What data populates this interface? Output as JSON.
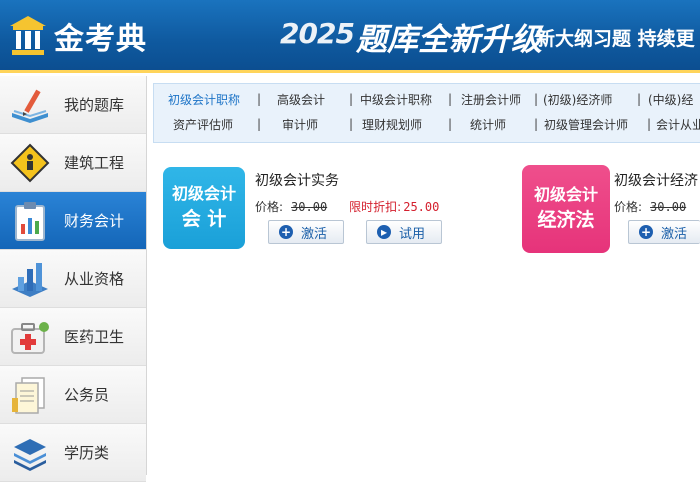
{
  "header": {
    "logo_text": "金考典",
    "banner_year": "2025",
    "banner_main": "题库全新升级",
    "banner_sub": "新大纲习题 持续更"
  },
  "sidebar": {
    "items": [
      {
        "label": "我的题库",
        "icon": "pencil-book-icon"
      },
      {
        "label": "建筑工程",
        "icon": "construction-sign-icon"
      },
      {
        "label": "财务会计",
        "icon": "clipboard-chart-icon"
      },
      {
        "label": "从业资格",
        "icon": "bar-chart-icon"
      },
      {
        "label": "医药卫生",
        "icon": "medical-kit-icon"
      },
      {
        "label": "公务员",
        "icon": "documents-icon"
      },
      {
        "label": "学历类",
        "icon": "layers-icon"
      }
    ],
    "active_index": 2
  },
  "tabs": {
    "row1": [
      "初级会计职称",
      "高级会计",
      "中级会计职称",
      "注册会计师",
      "(初级)经济师",
      "(中级)经"
    ],
    "row2": [
      "资产评估师",
      "审计师",
      "理财规划师",
      "统计师",
      "初级管理会计师",
      "会计从业"
    ],
    "active": "初级会计职称"
  },
  "courses": [
    {
      "badge_line1": "初级会计",
      "badge_line2": "会 计",
      "badge_color": "#1fa6dd",
      "title": "初级会计实务",
      "price_label": "价格:",
      "price_old": "30.00",
      "discount_label": "限时折扣:",
      "discount_price": "25.00",
      "activate_label": "激活",
      "trial_label": "试用"
    },
    {
      "badge_line1": "初级会计",
      "badge_line2": "经济法",
      "badge_color": "#e9397f",
      "title": "初级会计经济",
      "price_label": "价格:",
      "price_old": "30.00",
      "activate_label": "激活"
    }
  ]
}
